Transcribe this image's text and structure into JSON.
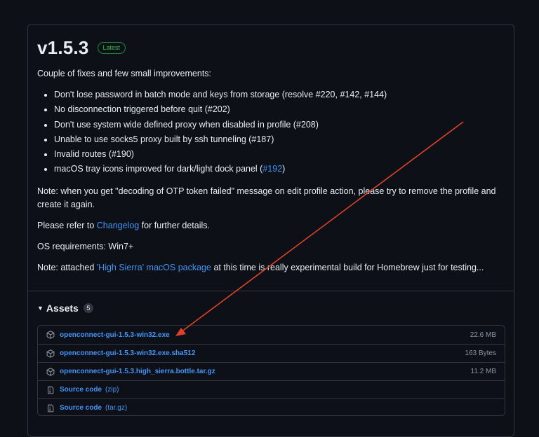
{
  "release": {
    "version": "v1.5.3",
    "badge": "Latest",
    "intro": "Couple of fixes and few small improvements:",
    "changes": [
      "Don't lose password in batch mode and keys from storage (resolve #220, #142, #144)",
      "No disconnection triggered before quit (#202)",
      "Don't use system wide defined proxy when disabled in profile (#208)",
      "Unable to use socks5 proxy built by ssh tunneling (#187)",
      "Invalid routes (#190)",
      "macOS tray icons improved for dark/light dock panel ("
    ],
    "change_last_link": "#192",
    "change_last_suffix": ")",
    "note1": "Note: when you get \"decoding of OTP token failed\" message on edit profile action, please try to remove the profile and create it again.",
    "refer_prefix": "Please refer to ",
    "refer_link": "Changelog",
    "refer_suffix": " for further details.",
    "os_req": "OS requirements: Win7+",
    "note2_prefix": "Note: attached ",
    "note2_link": "'High Sierra' macOS package",
    "note2_suffix": " at this time is really experimental build for Homebrew just for testing..."
  },
  "assets": {
    "title": "Assets",
    "count": "5",
    "items": [
      {
        "name": "openconnect-gui-1.5.3-win32.exe",
        "size": "22.6 MB",
        "icon": "package-icon"
      },
      {
        "name": "openconnect-gui-1.5.3-win32.exe.sha512",
        "size": "163 Bytes",
        "icon": "package-icon"
      },
      {
        "name": "openconnect-gui-1.5.3.high_sierra.bottle.tar.gz",
        "size": "11.2 MB",
        "icon": "package-icon"
      },
      {
        "name": "Source code",
        "ext": "(zip)",
        "icon": "zip-icon"
      },
      {
        "name": "Source code",
        "ext": "(tar.gz)",
        "icon": "zip-icon"
      }
    ]
  },
  "colors": {
    "background": "#0d1117",
    "link": "#4493f8",
    "badge": "#3fb950",
    "annotation_arrow": "#e0412a"
  }
}
